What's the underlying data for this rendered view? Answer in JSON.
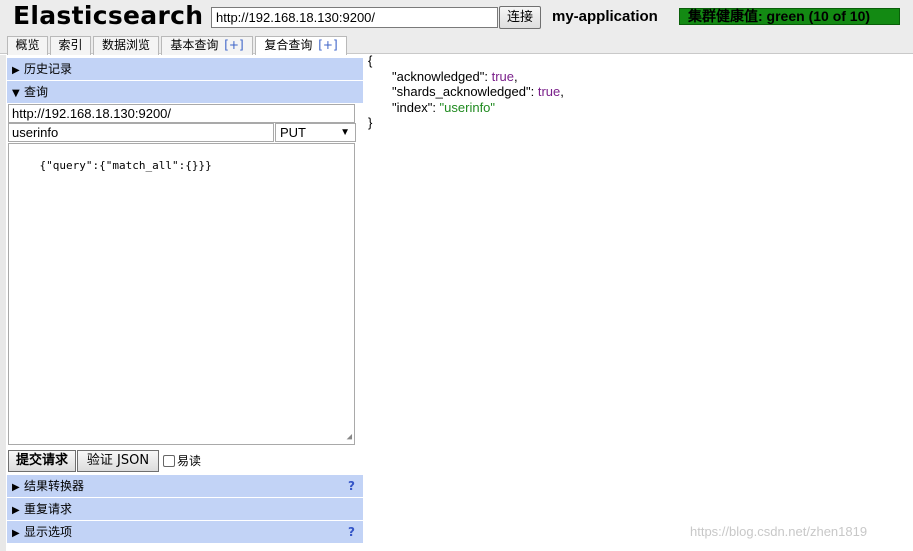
{
  "header": {
    "title": "Elasticsearch",
    "url": "http://192.168.18.130:9200/",
    "connect_label": "连接",
    "cluster_name": "my-application",
    "health": "集群健康值: green (10 of 10)",
    "health_color": "#138a13"
  },
  "tabs": [
    {
      "label": "概览",
      "plus": ""
    },
    {
      "label": "索引",
      "plus": ""
    },
    {
      "label": "数据浏览",
      "plus": ""
    },
    {
      "label": "基本查询",
      "plus": "[+]"
    },
    {
      "label": "复合查询",
      "plus": "[+]",
      "active": true
    }
  ],
  "left_panel": {
    "history_label": "历史记录",
    "query_label": "查询",
    "query_url": "http://192.168.18.130:9200/",
    "query_path": "userinfo",
    "method": "PUT",
    "body": "{\"query\":{\"match_all\":{}}}",
    "submit_label": "提交请求",
    "validate_label": "验证 JSON",
    "easy_read_label": "易读",
    "easy_read_checked": false,
    "transformer_label": "结果转换器",
    "repeat_label": "重复请求",
    "display_label": "显示选项",
    "help_mark": "?",
    "section_color": "#c2d3f6"
  },
  "result": {
    "open_brace": "{",
    "close_brace": "}",
    "lines": [
      {
        "key": "\"acknowledged\"",
        "sep": ": ",
        "value": "true",
        "tail": ","
      },
      {
        "key": "\"shards_acknowledged\"",
        "sep": ": ",
        "value": "true",
        "tail": ","
      },
      {
        "key": "\"index\"",
        "sep": ": ",
        "value": "\"userinfo\"",
        "tail": ""
      }
    ]
  },
  "watermark": "https://blog.csdn.net/zhen1819"
}
